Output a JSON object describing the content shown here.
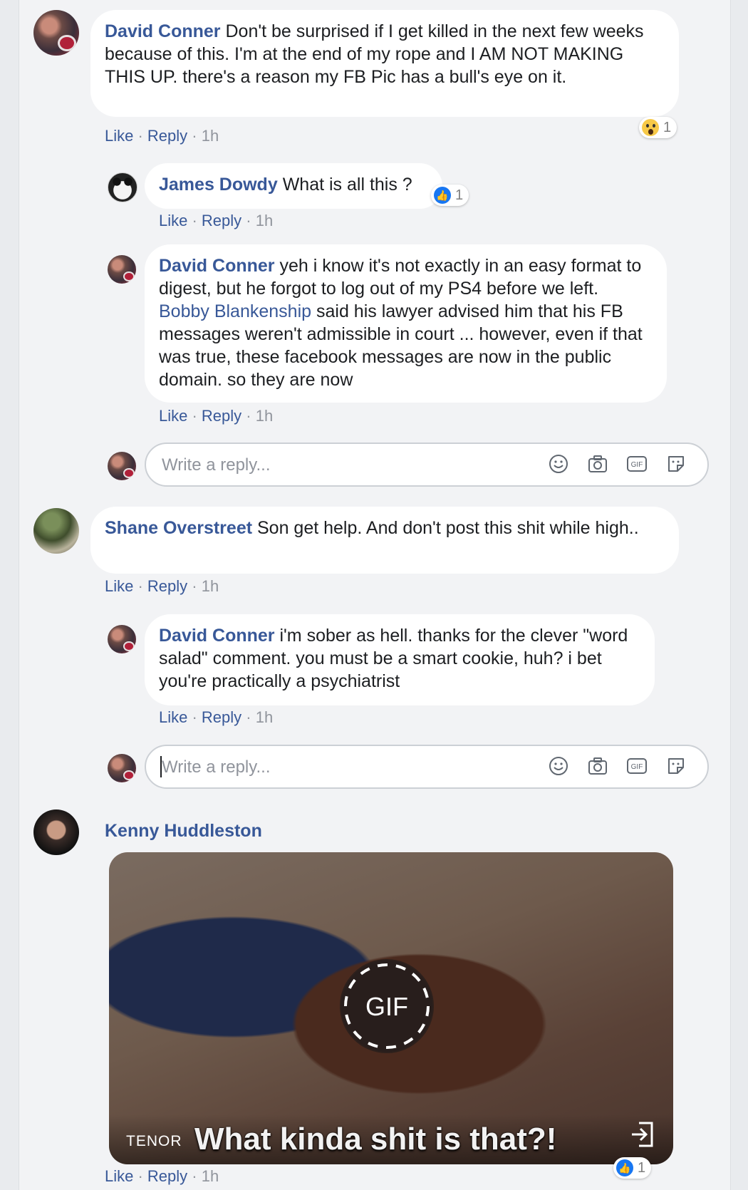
{
  "comments": [
    {
      "author": "David Conner",
      "text": "Don't be surprised if I get killed in the next few weeks because of this. I'm at the end of my rope and I AM NOT MAKING THIS UP. there's a reason my FB Pic has a bull's eye on it.",
      "like": "Like",
      "reply": "Reply",
      "time": "1h",
      "reaction_count": "1",
      "reaction_icon": "wow-reaction-icon"
    },
    {
      "author": "James Dowdy",
      "text": "What is all this ?",
      "like": "Like",
      "reply": "Reply",
      "time": "1h",
      "reaction_count": "1",
      "reaction_icon": "like-reaction-icon"
    },
    {
      "author": "David Conner",
      "text_before": "yeh i know it's not exactly in an easy format to digest, but he forgot to log out of my PS4 before we left.",
      "mention": "Bobby Blankenship",
      "text_after": "said his lawyer advised him that his FB messages weren't admissible in court ... however, even if that was true, these facebook messages are now in the public domain. so they are now",
      "like": "Like",
      "reply": "Reply",
      "time": "1h"
    },
    {
      "author": "Shane Overstreet",
      "text": "Son get help. And don't post this shit while high..",
      "like": "Like",
      "reply": "Reply",
      "time": "1h"
    },
    {
      "author": "David Conner",
      "text": "i'm sober as hell. thanks for the clever \"word salad\" comment. you must be a smart cookie, huh? i bet you're practically a psychiatrist",
      "like": "Like",
      "reply": "Reply",
      "time": "1h"
    },
    {
      "author": "Kenny Huddleston",
      "like": "Like",
      "reply": "Reply",
      "time": "1h",
      "reaction_count": "1",
      "reaction_icon": "like-reaction-icon",
      "gif": {
        "badge": "GIF",
        "source": "TENOR",
        "caption": "What kinda shit is that?!"
      }
    }
  ],
  "reply_box": {
    "placeholder": "Write a reply..."
  },
  "colors": {
    "link": "#385898",
    "meta": "#90949c",
    "bubble": "#ffffff",
    "background": "#f2f3f5",
    "like_blue": "#1877f2"
  }
}
